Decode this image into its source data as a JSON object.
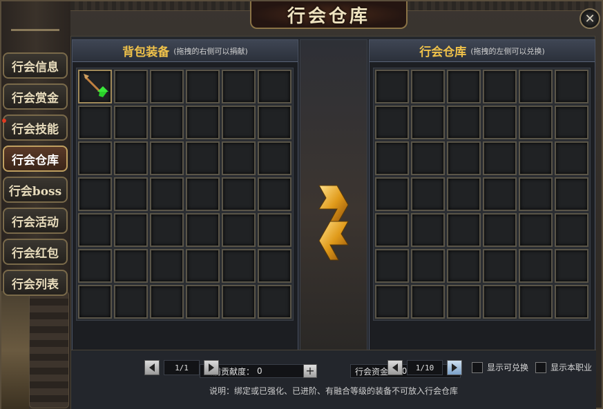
{
  "window": {
    "title": "行会仓库",
    "close_label": "✕"
  },
  "sidebar": {
    "items": [
      {
        "label": "行会信息",
        "active": false,
        "alert": false
      },
      {
        "label": "行会赏金",
        "active": false,
        "alert": false
      },
      {
        "label": "行会技能",
        "active": false,
        "alert": true
      },
      {
        "label": "行会仓库",
        "active": true,
        "alert": false
      },
      {
        "label": "行会boss",
        "active": false,
        "alert": false
      },
      {
        "label": "行会活动",
        "active": false,
        "alert": false
      },
      {
        "label": "行会红包",
        "active": false,
        "alert": false
      },
      {
        "label": "行会列表",
        "active": false,
        "alert": false
      }
    ]
  },
  "backpack": {
    "title": "背包装备",
    "subtitle": "(拖拽的右侧可以捐献)",
    "rows": 7,
    "cols": 6,
    "items": [
      {
        "slot": 0,
        "icon": "arrow-up-icon"
      }
    ],
    "page": "1/1"
  },
  "guild_storage": {
    "title": "行会仓库",
    "subtitle": "(拖拽的左侧可以兑换)",
    "rows": 7,
    "cols": 6,
    "page": "1/10",
    "filters": [
      {
        "label": "显示可兑换",
        "checked": false
      },
      {
        "label": "显示本职业",
        "checked": false
      }
    ]
  },
  "footer": {
    "contribution_label": "当前贡献度：",
    "contribution_value": "0",
    "plus_label": "+",
    "funds_label": "行会资金：",
    "funds_value": "5000",
    "note": "说明：绑定或已强化、已进阶、有融合等级的装备不可放入行会仓库"
  }
}
